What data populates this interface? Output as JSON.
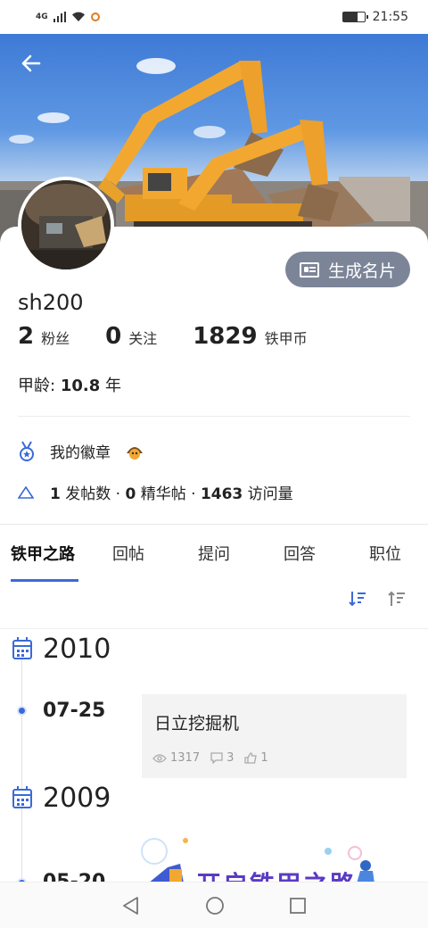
{
  "status_bar": {
    "network": "4G",
    "time": "21:55",
    "battery_level": 0.7
  },
  "profile": {
    "username": "sh200",
    "stats": [
      {
        "value": "2",
        "label": "粉丝"
      },
      {
        "value": "0",
        "label": "关注"
      },
      {
        "value": "1829",
        "label": "铁甲币"
      }
    ],
    "age_label": "甲龄:",
    "age_value": "10.8",
    "age_unit": "年",
    "namecard_button": "生成名片",
    "badge_label": "我的徽章",
    "posts": {
      "post_count": "1",
      "post_label": "发帖数",
      "elite_count": "0",
      "elite_label": "精华帖",
      "visit_count": "1463",
      "visit_label": "访问量",
      "sep": "·"
    }
  },
  "tabs": [
    {
      "label": "铁甲之路",
      "active": true
    },
    {
      "label": "回帖",
      "active": false
    },
    {
      "label": "提问",
      "active": false
    },
    {
      "label": "回答",
      "active": false
    },
    {
      "label": "职位",
      "active": false
    }
  ],
  "timeline": {
    "years": [
      "2010",
      "2009"
    ],
    "entries": [
      {
        "date": "07-25",
        "title": "日立挖掘机",
        "views": "1317",
        "comments": "3",
        "likes": "1"
      }
    ],
    "partial_date": "05-20",
    "banner_text": "开启铁甲之路"
  },
  "colors": {
    "accent": "#3a6ad8",
    "namecard_bg": "#7c8598",
    "excavator": "#f2a830"
  },
  "icons": [
    "back-arrow-icon",
    "id-card-icon",
    "medal-icon",
    "triangle-icon",
    "sort-desc-icon",
    "sort-asc-icon",
    "calendar-icon",
    "eye-icon",
    "comment-icon",
    "thumb-up-icon"
  ]
}
